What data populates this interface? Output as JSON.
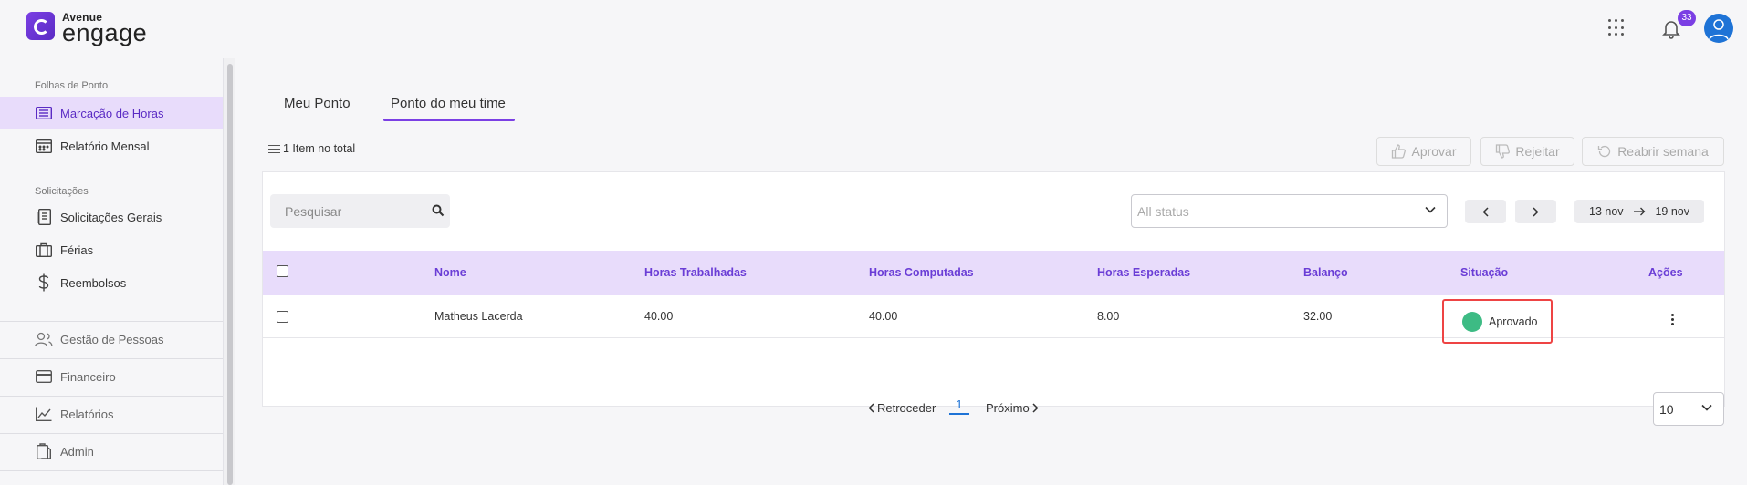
{
  "header": {
    "logo_top": "Avenue",
    "logo_main": "engage",
    "notification_count": "33"
  },
  "sidebar": {
    "sections": [
      {
        "label": "Folhas de Ponto"
      },
      {
        "label": "Solicitações"
      }
    ],
    "items": [
      {
        "label": "Marcação de Horas",
        "icon": "list-icon",
        "active": true
      },
      {
        "label": "Relatório Mensal",
        "icon": "calendar-icon"
      },
      {
        "label": "Solicitações Gerais",
        "icon": "document-icon"
      },
      {
        "label": "Férias",
        "icon": "briefcase-icon"
      },
      {
        "label": "Reembolsos",
        "icon": "dollar-icon"
      },
      {
        "label": "Gestão de Pessoas",
        "icon": "people-icon"
      },
      {
        "label": "Financeiro",
        "icon": "card-icon"
      },
      {
        "label": "Relatórios",
        "icon": "chart-icon"
      },
      {
        "label": "Admin",
        "icon": "clipboard-icon"
      }
    ]
  },
  "tabs": [
    {
      "label": "Meu Ponto"
    },
    {
      "label": "Ponto do meu time",
      "active": true
    }
  ],
  "toolbar": {
    "total": "1 Item no total",
    "approve_label": "Aprovar",
    "reject_label": "Rejeitar",
    "reopen_label": "Reabrir semana"
  },
  "filters": {
    "search_placeholder": "Pesquisar",
    "status_placeholder": "All status",
    "date_start": "13 nov",
    "date_end": "19 nov"
  },
  "table": {
    "columns": [
      "Nome",
      "Horas Trabalhadas",
      "Horas Computadas",
      "Horas Esperadas",
      "Balanço",
      "Situação",
      "Ações"
    ],
    "rows": [
      {
        "nome": "Matheus Lacerda",
        "horas_trabalhadas": "40.00",
        "horas_computadas": "40.00",
        "horas_esperadas": "8.00",
        "balanco": "32.00",
        "situacao": "Aprovado",
        "status_color": "#3dbb84"
      }
    ]
  },
  "pagination": {
    "prev_label": "Retroceder",
    "current_page": "1",
    "next_label": "Próximo",
    "page_size": "10"
  },
  "colors": {
    "accent": "#7b3fe4",
    "header_bg": "#e8dcfb",
    "approved": "#3dbb84",
    "highlight_border": "#e44444"
  }
}
